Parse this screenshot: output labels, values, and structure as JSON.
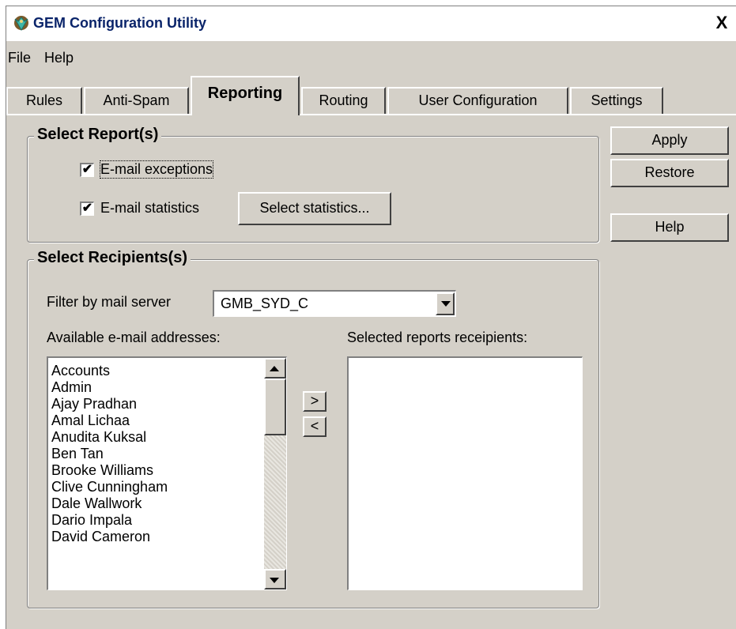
{
  "window": {
    "title": "GEM Configuration Utility",
    "close_glyph": "X"
  },
  "menu": {
    "items": [
      {
        "label": "File"
      },
      {
        "label": "Help"
      }
    ]
  },
  "tabs": [
    {
      "label": "Rules"
    },
    {
      "label": "Anti-Spam"
    },
    {
      "label": "Reporting",
      "active": true
    },
    {
      "label": "Routing"
    },
    {
      "label": "User Configuration"
    },
    {
      "label": "Settings"
    }
  ],
  "select_reports": {
    "legend": "Select Report(s)",
    "email_exceptions": {
      "label": "E-mail exceptions",
      "checked": true
    },
    "email_statistics": {
      "label": "E-mail statistics",
      "checked": true
    },
    "select_statistics_button": "Select statistics..."
  },
  "side_buttons": {
    "apply": "Apply",
    "restore": "Restore",
    "help": "Help"
  },
  "select_recipients": {
    "legend": "Select Recipients(s)",
    "filter_label": "Filter by mail server",
    "filter_value": "GMB_SYD_C",
    "available_label": "Available e-mail addresses:",
    "selected_label": "Selected reports receipients:",
    "add_button": ">",
    "remove_button": "<",
    "available_addresses": [
      "Accounts",
      "Admin",
      "Ajay Pradhan",
      "Amal Lichaa",
      "Anudita Kuksal",
      "Ben Tan",
      "Brooke Williams",
      "Clive Cunningham",
      "Dale Wallwork",
      "Dario Impala",
      "David Cameron"
    ],
    "selected_recipients": []
  },
  "check_glyph": "✔"
}
